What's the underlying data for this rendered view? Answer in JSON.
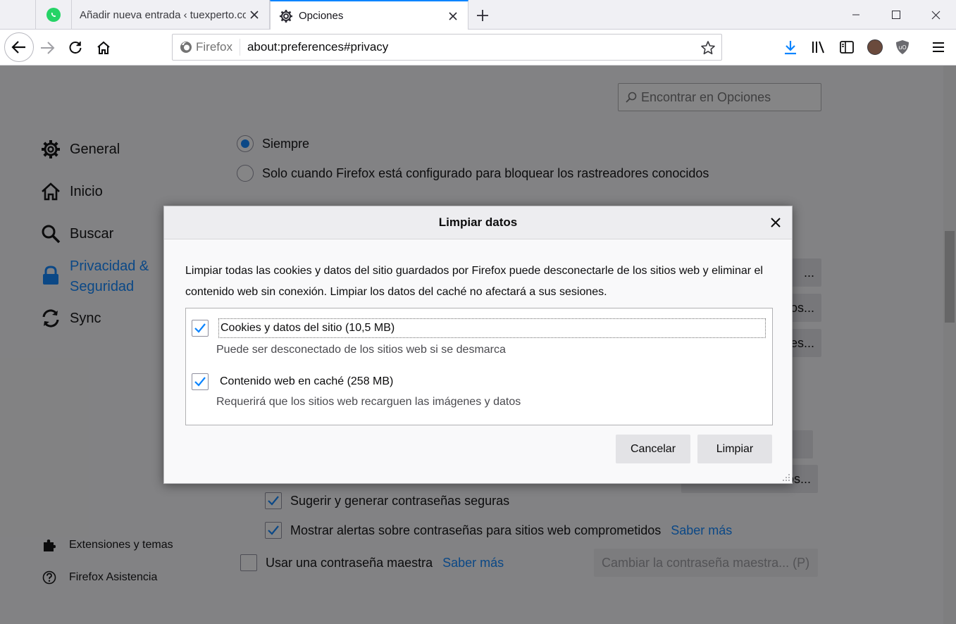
{
  "tabs": [
    {
      "title": "",
      "icon": "whatsapp-icon"
    },
    {
      "title": "Añadir nueva entrada ‹ tuexperto.co",
      "icon": ""
    },
    {
      "title": "Opciones",
      "icon": "gear-icon",
      "active": true
    }
  ],
  "toolbar": {
    "identity_label": "Firefox",
    "url": "about:preferences#privacy"
  },
  "prefs": {
    "search_placeholder": "Encontrar en Opciones",
    "categories": [
      {
        "label": "General",
        "icon": "gear-icon"
      },
      {
        "label": "Inicio",
        "icon": "home-icon"
      },
      {
        "label": "Buscar",
        "icon": "search-icon"
      },
      {
        "label": "Privacidad &\nSeguridad",
        "icon": "lock-icon",
        "selected": true
      },
      {
        "label": "Sync",
        "icon": "sync-icon"
      }
    ],
    "footer": [
      {
        "label": "Extensiones y temas",
        "icon": "puzzle-icon"
      },
      {
        "label": "Firefox Asistencia",
        "icon": "help-icon"
      }
    ],
    "radio_always": "Siempre",
    "radio_only_when": "Solo cuando Firefox está configurado para bloquear los rastreadores conocidos",
    "bg_buttons": [
      "...",
      "os...",
      "es...",
      "",
      "os..."
    ],
    "suggest_passwords": "Sugerir y generar contraseñas seguras",
    "breach_alerts": "Mostrar alertas sobre contraseñas para sitios web comprometidos",
    "learn_more": "Saber más",
    "master_password": "Usar una contraseña maestra",
    "change_master": "Cambiar la contraseña maestra... (P)"
  },
  "dialog": {
    "title": "Limpiar datos",
    "description": "Limpiar todas las cookies y datos del sitio guardados por Firefox puede desconectarle de los sitios web y eliminar el contenido web sin conexión. Limpiar los datos del caché no afectará a sus sesiones.",
    "options": [
      {
        "label": "Cookies y datos del sitio (10,5 MB)",
        "sub": "Puede ser desconectado de los sitios web si se desmarca",
        "checked": true
      },
      {
        "label": "Contenido web en caché (258 MB)",
        "sub": "Requerirá que los sitios web recarguen las imágenes y datos",
        "checked": true
      }
    ],
    "cancel": "Cancelar",
    "clear": "Limpiar"
  }
}
